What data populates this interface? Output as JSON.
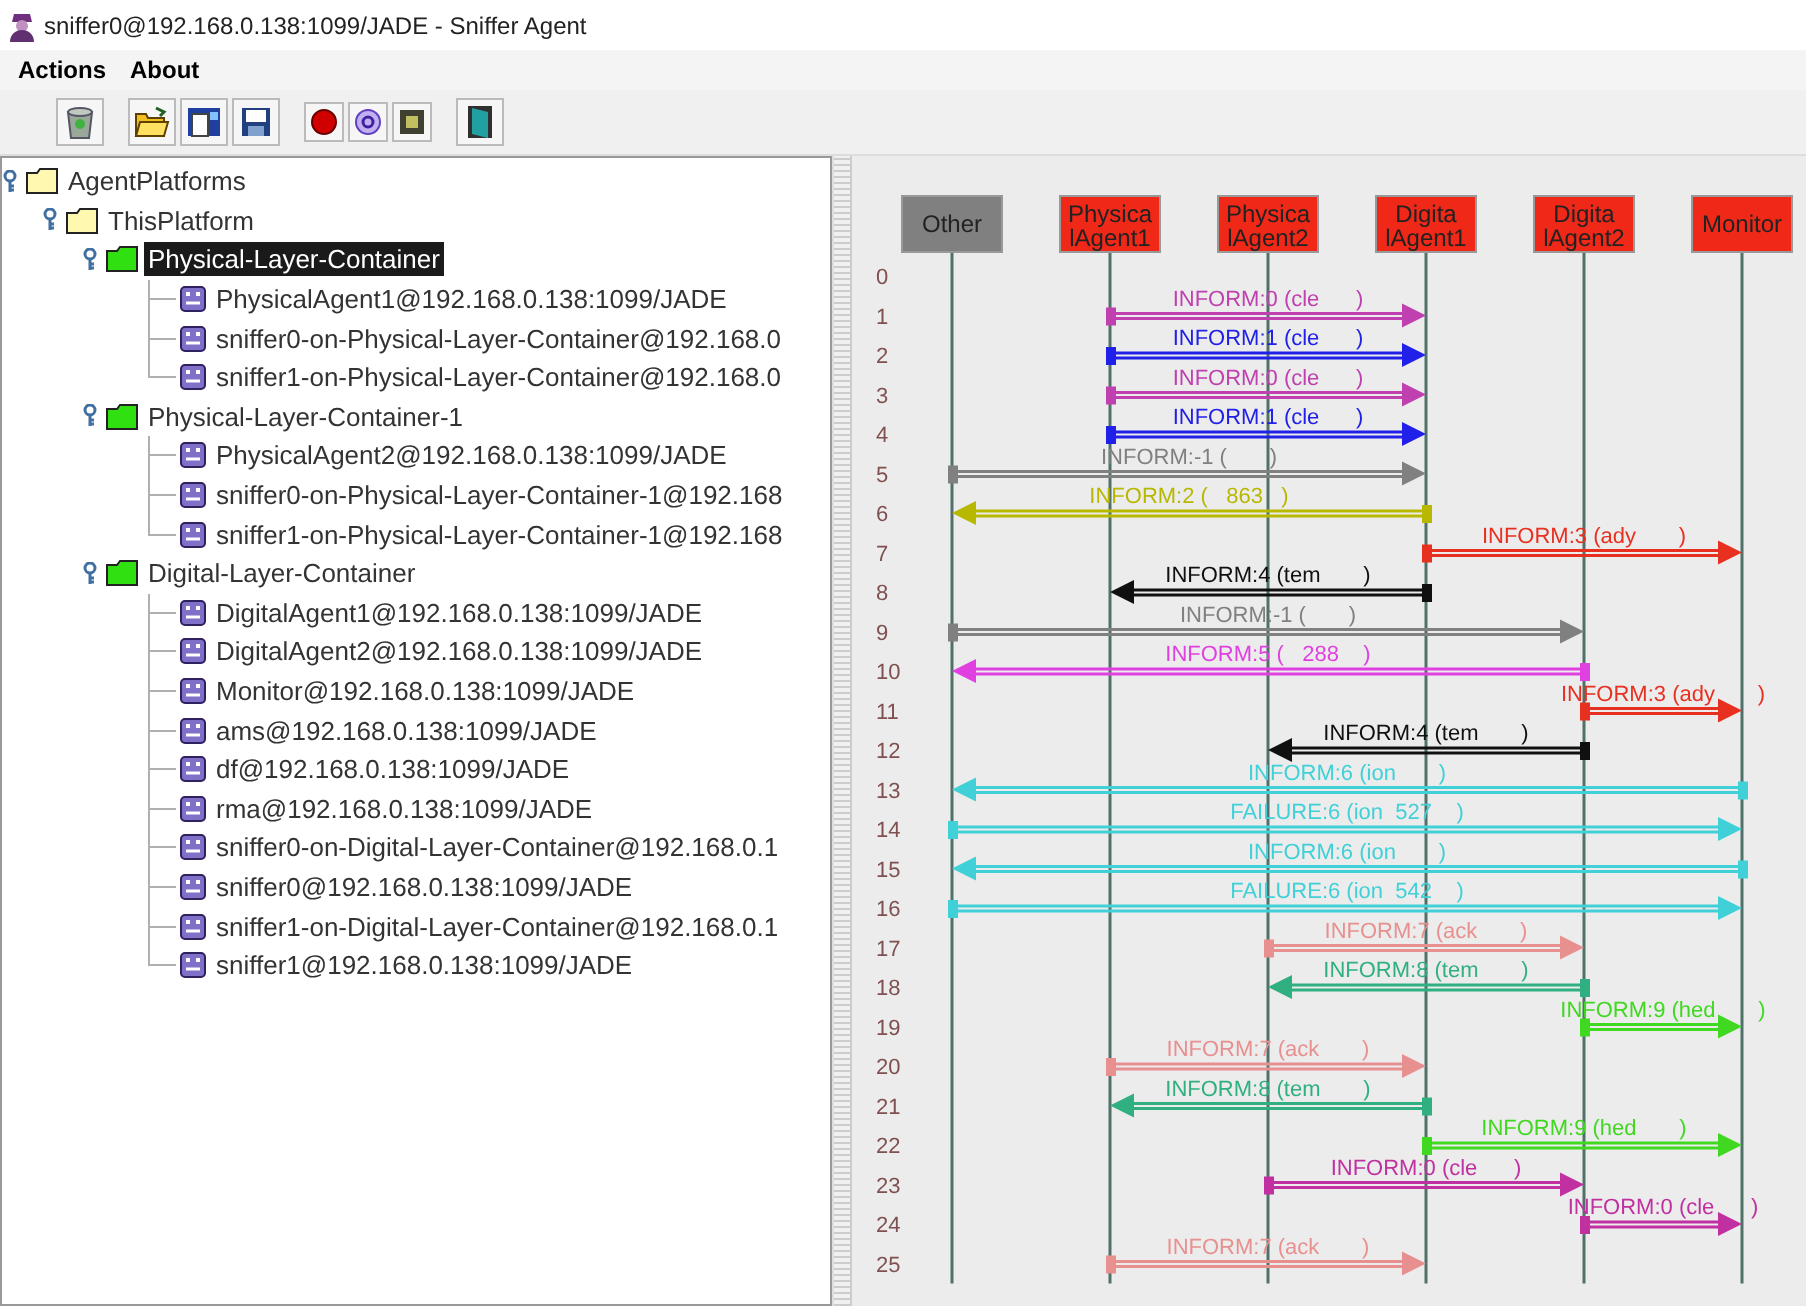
{
  "window": {
    "title": "sniffer0@192.168.0.138:1099/JADE - Sniffer Agent"
  },
  "menu": [
    "Actions",
    "About"
  ],
  "tree": [
    {
      "label": "AgentPlatforms",
      "kind": "platform",
      "expanded": true,
      "selected": false,
      "children": [
        {
          "label": "ThisPlatform",
          "kind": "platform",
          "expanded": true,
          "selected": false,
          "children": [
            {
              "label": "Physical-Layer-Container",
              "kind": "container",
              "expanded": true,
              "selected": true,
              "children": [
                {
                  "label": "PhysicalAgent1@192.168.0.138:1099/JADE",
                  "kind": "agent",
                  "selected": false
                },
                {
                  "label": "sniffer0-on-Physical-Layer-Container@192.168.0",
                  "kind": "agent",
                  "selected": false
                },
                {
                  "label": "sniffer1-on-Physical-Layer-Container@192.168.0",
                  "kind": "agent",
                  "selected": false
                }
              ]
            },
            {
              "label": "Physical-Layer-Container-1",
              "kind": "container",
              "expanded": true,
              "selected": false,
              "children": [
                {
                  "label": "PhysicalAgent2@192.168.0.138:1099/JADE",
                  "kind": "agent",
                  "selected": false
                },
                {
                  "label": "sniffer0-on-Physical-Layer-Container-1@192.168",
                  "kind": "agent",
                  "selected": false
                },
                {
                  "label": "sniffer1-on-Physical-Layer-Container-1@192.168",
                  "kind": "agent",
                  "selected": false
                }
              ]
            },
            {
              "label": "Digital-Layer-Container",
              "kind": "container",
              "expanded": true,
              "selected": false,
              "children": [
                {
                  "label": "DigitalAgent1@192.168.0.138:1099/JADE",
                  "kind": "agent",
                  "selected": false
                },
                {
                  "label": "DigitalAgent2@192.168.0.138:1099/JADE",
                  "kind": "agent",
                  "selected": false
                },
                {
                  "label": "Monitor@192.168.0.138:1099/JADE",
                  "kind": "agent",
                  "selected": false
                },
                {
                  "label": "ams@192.168.0.138:1099/JADE",
                  "kind": "agent",
                  "selected": false
                },
                {
                  "label": "df@192.168.0.138:1099/JADE",
                  "kind": "agent",
                  "selected": false
                },
                {
                  "label": "rma@192.168.0.138:1099/JADE",
                  "kind": "agent",
                  "selected": false
                },
                {
                  "label": "sniffer0-on-Digital-Layer-Container@192.168.0.1",
                  "kind": "agent",
                  "selected": false
                },
                {
                  "label": "sniffer0@192.168.0.138:1099/JADE",
                  "kind": "agent",
                  "selected": false
                },
                {
                  "label": "sniffer1-on-Digital-Layer-Container@192.168.0.1",
                  "kind": "agent",
                  "selected": false
                },
                {
                  "label": "sniffer1@192.168.0.138:1099/JADE",
                  "kind": "agent",
                  "selected": false
                }
              ]
            }
          ]
        }
      ]
    }
  ],
  "diagram": {
    "agents": [
      {
        "lines": [
          "Other"
        ],
        "color": "#808080"
      },
      {
        "lines": [
          "Physica",
          "lAgent1"
        ],
        "color": "#f02818"
      },
      {
        "lines": [
          "Physica",
          "lAgent2"
        ],
        "color": "#f02818"
      },
      {
        "lines": [
          "Digita",
          "lAgent1"
        ],
        "color": "#f02818"
      },
      {
        "lines": [
          "Digita",
          "lAgent2"
        ],
        "color": "#f02818"
      },
      {
        "lines": [
          "Monitor"
        ],
        "color": "#f02818"
      }
    ],
    "rows": [
      {
        "number": "0"
      },
      {
        "number": "1",
        "message": {
          "label": "INFORM:0 (cle      )",
          "color": "#c040b0",
          "lanes": [
            {
              "kind": "off"
            },
            {
              "kind": "tail"
            },
            {
              "kind": "pass"
            },
            {
              "kind": "head"
            },
            {
              "kind": "off"
            },
            {
              "kind": "off"
            }
          ]
        }
      },
      {
        "number": "2",
        "message": {
          "label": "INFORM:1 (cle      )",
          "color": "#2020e8",
          "lanes": [
            {
              "kind": "off"
            },
            {
              "kind": "tail"
            },
            {
              "kind": "pass"
            },
            {
              "kind": "head"
            },
            {
              "kind": "off"
            },
            {
              "kind": "off"
            }
          ]
        }
      },
      {
        "number": "3",
        "message": {
          "label": "INFORM:0 (cle      )",
          "color": "#c040b0",
          "lanes": [
            {
              "kind": "off"
            },
            {
              "kind": "tail"
            },
            {
              "kind": "pass"
            },
            {
              "kind": "head"
            },
            {
              "kind": "off"
            },
            {
              "kind": "off"
            }
          ]
        }
      },
      {
        "number": "4",
        "message": {
          "label": "INFORM:1 (cle      )",
          "color": "#2020e8",
          "lanes": [
            {
              "kind": "off"
            },
            {
              "kind": "tail"
            },
            {
              "kind": "pass"
            },
            {
              "kind": "head"
            },
            {
              "kind": "off"
            },
            {
              "kind": "off"
            }
          ]
        }
      },
      {
        "number": "5",
        "message": {
          "label": "INFORM:-1 (       )",
          "color": "#808080",
          "lanes": [
            {
              "kind": "tail"
            },
            {
              "kind": "pass"
            },
            {
              "kind": "pass"
            },
            {
              "kind": "head"
            },
            {
              "kind": "off"
            },
            {
              "kind": "off"
            }
          ]
        }
      },
      {
        "number": "6",
        "message": {
          "label": "INFORM:2 (   863   )",
          "color": "#b8b800",
          "lanes": [
            {
              "kind": "head"
            },
            {
              "kind": "pass"
            },
            {
              "kind": "pass"
            },
            {
              "kind": "tail"
            },
            {
              "kind": "off"
            },
            {
              "kind": "off"
            }
          ]
        }
      },
      {
        "number": "7",
        "message": {
          "label": "INFORM:3 (ady       )",
          "color": "#e83020",
          "lanes": [
            {
              "kind": "off"
            },
            {
              "kind": "off"
            },
            {
              "kind": "off"
            },
            {
              "kind": "tail"
            },
            {
              "kind": "pass"
            },
            {
              "kind": "head"
            }
          ]
        }
      },
      {
        "number": "8",
        "message": {
          "label": "INFORM:4 (tem       )",
          "color": "#101010",
          "lanes": [
            {
              "kind": "off"
            },
            {
              "kind": "head"
            },
            {
              "kind": "pass"
            },
            {
              "kind": "tail"
            },
            {
              "kind": "off"
            },
            {
              "kind": "off"
            }
          ]
        }
      },
      {
        "number": "9",
        "message": {
          "label": "INFORM:-1 (       )",
          "color": "#808080",
          "lanes": [
            {
              "kind": "tail"
            },
            {
              "kind": "pass"
            },
            {
              "kind": "pass"
            },
            {
              "kind": "pass"
            },
            {
              "kind": "head"
            },
            {
              "kind": "off"
            }
          ]
        }
      },
      {
        "number": "10",
        "message": {
          "label": "INFORM:5 (   288    )",
          "color": "#e040e0",
          "lanes": [
            {
              "kind": "head"
            },
            {
              "kind": "pass"
            },
            {
              "kind": "pass"
            },
            {
              "kind": "pass"
            },
            {
              "kind": "tail"
            },
            {
              "kind": "off"
            }
          ]
        }
      },
      {
        "number": "11",
        "message": {
          "label": "INFORM:3 (ady       )",
          "color": "#e83020",
          "lanes": [
            {
              "kind": "off"
            },
            {
              "kind": "off"
            },
            {
              "kind": "off"
            },
            {
              "kind": "off"
            },
            {
              "kind": "tail"
            },
            {
              "kind": "head"
            }
          ]
        }
      },
      {
        "number": "12",
        "message": {
          "label": "INFORM:4 (tem       )",
          "color": "#101010",
          "lanes": [
            {
              "kind": "off"
            },
            {
              "kind": "off"
            },
            {
              "kind": "head"
            },
            {
              "kind": "pass"
            },
            {
              "kind": "tail"
            },
            {
              "kind": "off"
            }
          ]
        }
      },
      {
        "number": "13",
        "message": {
          "label": "INFORM:6 (ion       )",
          "color": "#40d0d8",
          "lanes": [
            {
              "kind": "head"
            },
            {
              "kind": "pass"
            },
            {
              "kind": "pass"
            },
            {
              "kind": "pass"
            },
            {
              "kind": "pass"
            },
            {
              "kind": "tail"
            }
          ]
        }
      },
      {
        "number": "14",
        "message": {
          "label": "FAILURE:6 (ion  527    )",
          "color": "#40d0d8",
          "lanes": [
            {
              "kind": "tail"
            },
            {
              "kind": "pass"
            },
            {
              "kind": "pass"
            },
            {
              "kind": "pass"
            },
            {
              "kind": "pass"
            },
            {
              "kind": "head"
            }
          ]
        }
      },
      {
        "number": "15",
        "message": {
          "label": "INFORM:6 (ion       )",
          "color": "#40d0d8",
          "lanes": [
            {
              "kind": "head"
            },
            {
              "kind": "pass"
            },
            {
              "kind": "pass"
            },
            {
              "kind": "pass"
            },
            {
              "kind": "pass"
            },
            {
              "kind": "tail"
            }
          ]
        }
      },
      {
        "number": "16",
        "message": {
          "label": "FAILURE:6 (ion  542    )",
          "color": "#40d0d8",
          "lanes": [
            {
              "kind": "tail"
            },
            {
              "kind": "pass"
            },
            {
              "kind": "pass"
            },
            {
              "kind": "pass"
            },
            {
              "kind": "pass"
            },
            {
              "kind": "head"
            }
          ]
        }
      },
      {
        "number": "17",
        "message": {
          "label": "INFORM:7 (ack       )",
          "color": "#e89090",
          "lanes": [
            {
              "kind": "off"
            },
            {
              "kind": "off"
            },
            {
              "kind": "tail"
            },
            {
              "kind": "pass"
            },
            {
              "kind": "head"
            },
            {
              "kind": "off"
            }
          ]
        }
      },
      {
        "number": "18",
        "message": {
          "label": "INFORM:8 (tem       )",
          "color": "#30b080",
          "lanes": [
            {
              "kind": "off"
            },
            {
              "kind": "off"
            },
            {
              "kind": "head"
            },
            {
              "kind": "pass"
            },
            {
              "kind": "tail"
            },
            {
              "kind": "off"
            }
          ]
        }
      },
      {
        "number": "19",
        "message": {
          "label": "INFORM:9 (hed       )",
          "color": "#40d820",
          "lanes": [
            {
              "kind": "off"
            },
            {
              "kind": "off"
            },
            {
              "kind": "off"
            },
            {
              "kind": "off"
            },
            {
              "kind": "tail"
            },
            {
              "kind": "head"
            }
          ]
        }
      },
      {
        "number": "20",
        "message": {
          "label": "INFORM:7 (ack       )",
          "color": "#e89090",
          "lanes": [
            {
              "kind": "off"
            },
            {
              "kind": "tail"
            },
            {
              "kind": "pass"
            },
            {
              "kind": "head"
            },
            {
              "kind": "off"
            },
            {
              "kind": "off"
            }
          ]
        }
      },
      {
        "number": "21",
        "message": {
          "label": "INFORM:8 (tem       )",
          "color": "#30b080",
          "lanes": [
            {
              "kind": "off"
            },
            {
              "kind": "head"
            },
            {
              "kind": "pass"
            },
            {
              "kind": "tail"
            },
            {
              "kind": "off"
            },
            {
              "kind": "off"
            }
          ]
        }
      },
      {
        "number": "22",
        "message": {
          "label": "INFORM:9 (hed       )",
          "color": "#40d820",
          "lanes": [
            {
              "kind": "off"
            },
            {
              "kind": "off"
            },
            {
              "kind": "off"
            },
            {
              "kind": "tail"
            },
            {
              "kind": "pass"
            },
            {
              "kind": "head"
            }
          ]
        }
      },
      {
        "number": "23",
        "message": {
          "label": "INFORM:0 (cle      )",
          "color": "#c030a0",
          "lanes": [
            {
              "kind": "off"
            },
            {
              "kind": "off"
            },
            {
              "kind": "tail"
            },
            {
              "kind": "pass"
            },
            {
              "kind": "head"
            },
            {
              "kind": "off"
            }
          ]
        }
      },
      {
        "number": "24",
        "message": {
          "label": "INFORM:0 (cle      )",
          "color": "#c030a0",
          "lanes": [
            {
              "kind": "off"
            },
            {
              "kind": "off"
            },
            {
              "kind": "off"
            },
            {
              "kind": "off"
            },
            {
              "kind": "tail"
            },
            {
              "kind": "head"
            }
          ]
        }
      },
      {
        "number": "25",
        "message": {
          "label": "INFORM:7 (ack       )",
          "color": "#e89090",
          "lanes": [
            {
              "kind": "off"
            },
            {
              "kind": "tail"
            },
            {
              "kind": "pass"
            },
            {
              "kind": "head"
            },
            {
              "kind": "off"
            },
            {
              "kind": "off"
            }
          ]
        }
      }
    ]
  }
}
